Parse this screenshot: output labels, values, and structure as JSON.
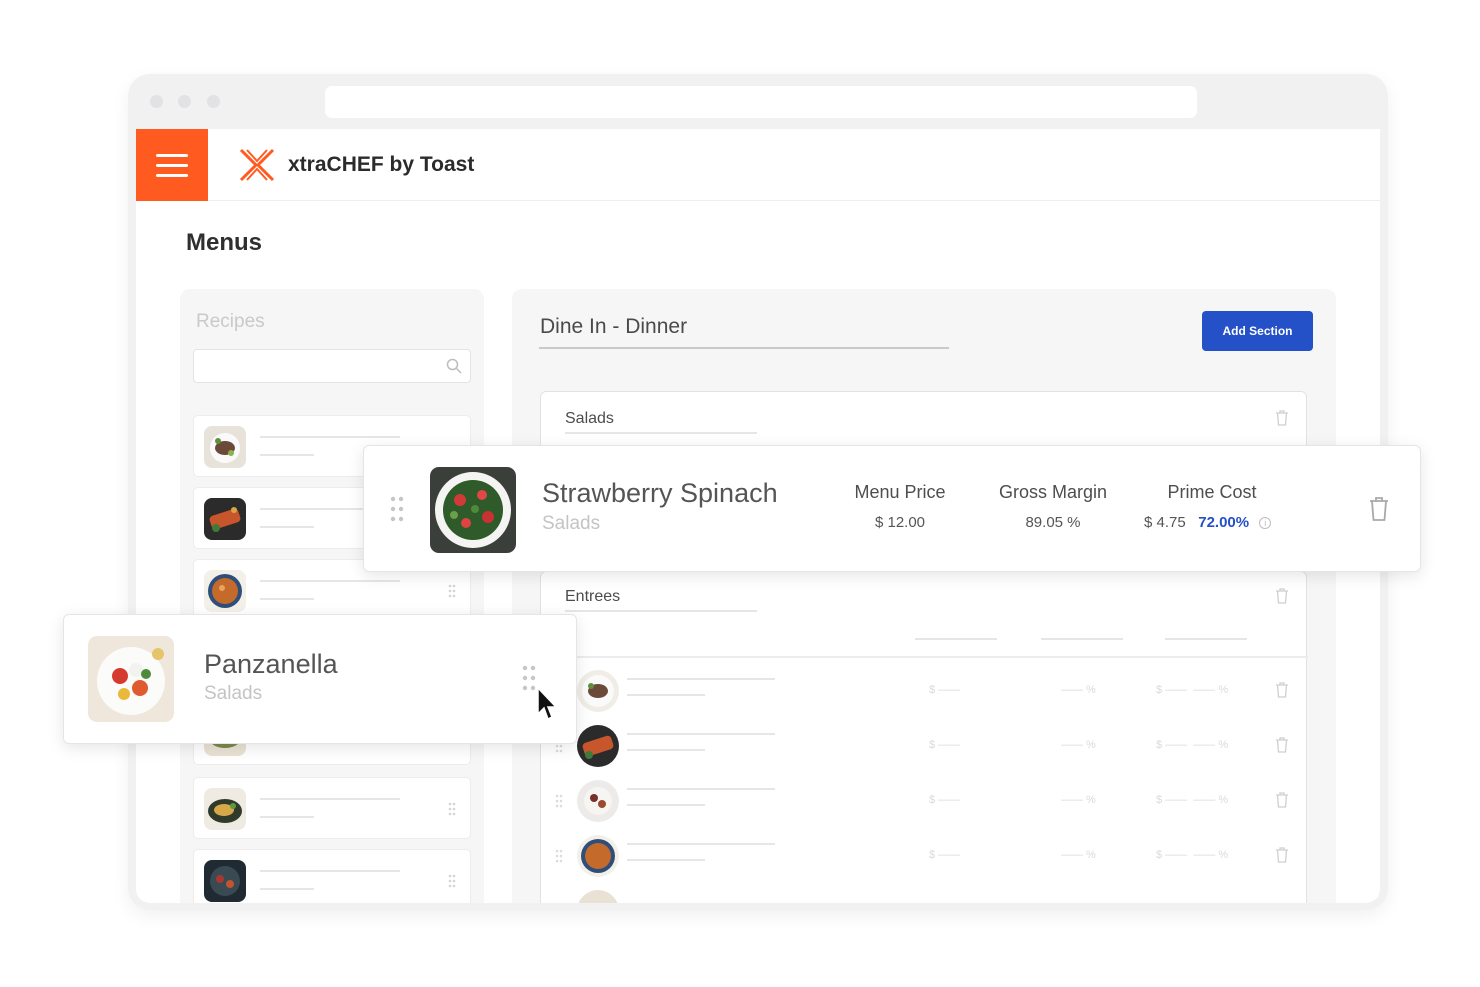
{
  "app": {
    "brand_name": "xtraCHEF by Toast",
    "page_title": "Menus"
  },
  "colors": {
    "accent": "#ff5a1f",
    "primary_button": "#2450c8",
    "percent_text": "#2450c8"
  },
  "recipes_panel": {
    "label": "Recipes",
    "search": {
      "value": "",
      "placeholder": ""
    }
  },
  "menu_panel": {
    "menu_name": "Dine In - Dinner",
    "add_section_label": "Add Section",
    "sections": [
      {
        "title": "Salads"
      },
      {
        "title": "Entrees"
      }
    ]
  },
  "dragged_menu_item": {
    "name": "Strawberry Spinach",
    "category": "Salads",
    "menu_price_label": "Menu Price",
    "menu_price_value": "$ 12.00",
    "gross_margin_label": "Gross Margin",
    "gross_margin_value": "89.05 %",
    "prime_cost_label": "Prime Cost",
    "prime_cost_value": "$ 4.75",
    "prime_cost_percent": "72.00%"
  },
  "dragged_recipe": {
    "name": "Panzanella",
    "category": "Salads"
  },
  "icons": [
    "hamburger-menu-icon",
    "xtrachef-logo-icon",
    "search-icon",
    "drag-handle-icon",
    "trash-icon",
    "info-icon",
    "mouse-cursor-icon"
  ]
}
